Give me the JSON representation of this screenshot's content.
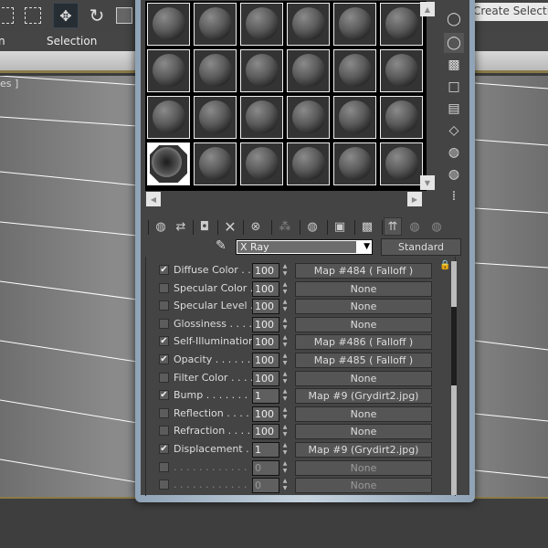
{
  "toolbar": {
    "icons": [
      "select-region-icon",
      "window-crossing-icon",
      "select-move-icon",
      "select-rotate-icon",
      "select-scale-icon"
    ],
    "named_selection": "Create Selection Se"
  },
  "menubar": {
    "items": [
      "n",
      "Selection"
    ]
  },
  "viewport": {
    "label": "es ]"
  },
  "material_editor": {
    "slots": {
      "rows": 4,
      "cols": 6,
      "active_index": 18
    },
    "side_icons": [
      "sample-type-icon",
      "backlight-icon",
      "background-icon",
      "sample-uv-tiling-icon",
      "video-color-check-icon",
      "make-preview-icon",
      "options-icon",
      "select-by-material-icon",
      "material-map-navigator-icon"
    ],
    "toolbar_icons": [
      "get-material-icon",
      "put-to-scene-icon",
      "assign-to-selection-icon",
      "reset-map-icon",
      "make-unique-icon",
      "put-to-library-icon",
      "material-id-channel-icon",
      "show-map-in-viewport-icon",
      "show-end-result-icon",
      "go-to-parent-icon",
      "go-forward-icon"
    ],
    "material_name": "X Ray",
    "material_type": "Standard",
    "maps": [
      {
        "enabled": true,
        "label": "Diffuse Color . . .",
        "amount": "100",
        "map": "Map #484  ( Falloff )",
        "dim": false
      },
      {
        "enabled": false,
        "label": "Specular Color  .",
        "amount": "100",
        "map": "None",
        "dim": false
      },
      {
        "enabled": false,
        "label": "Specular Level  .",
        "amount": "100",
        "map": "None",
        "dim": false
      },
      {
        "enabled": false,
        "label": "Glossiness  . . . .",
        "amount": "100",
        "map": "None",
        "dim": false
      },
      {
        "enabled": true,
        "label": "Self-Illumination .",
        "amount": "100",
        "map": "Map #486  ( Falloff )",
        "dim": false
      },
      {
        "enabled": true,
        "label": "Opacity . . . . . .",
        "amount": "100",
        "map": "Map #485  ( Falloff )",
        "dim": false
      },
      {
        "enabled": false,
        "label": "Filter Color  . . . .",
        "amount": "100",
        "map": "None",
        "dim": false
      },
      {
        "enabled": true,
        "label": "Bump  . . . . . . .",
        "amount": "1",
        "map": "Map #9 (Grydirt2.jpg)",
        "dim": false
      },
      {
        "enabled": false,
        "label": "Reflection  . . . .",
        "amount": "100",
        "map": "None",
        "dim": false
      },
      {
        "enabled": false,
        "label": "Refraction  . . . .",
        "amount": "100",
        "map": "None",
        "dim": false
      },
      {
        "enabled": true,
        "label": "Displacement  . .",
        "amount": "1",
        "map": "Map #9 (Grydirt2.jpg)",
        "dim": false
      },
      {
        "enabled": false,
        "label": ". . . . . . . . . . . .",
        "amount": "0",
        "map": "None",
        "dim": true
      },
      {
        "enabled": false,
        "label": ". . . . . . . . . . . .",
        "amount": "0",
        "map": "None",
        "dim": true
      }
    ]
  }
}
